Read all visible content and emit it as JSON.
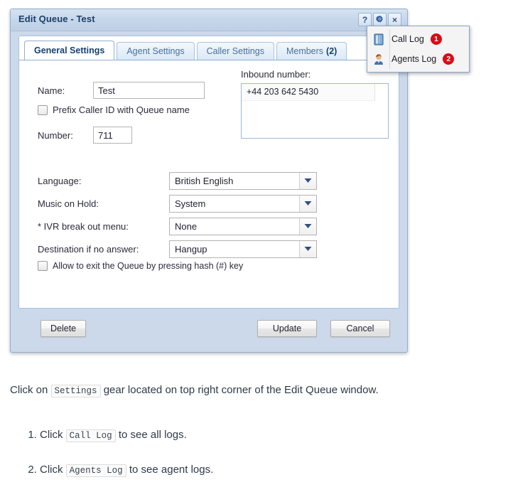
{
  "dialog": {
    "title": "Edit Queue - Test",
    "titlebar_buttons": [
      {
        "name": "help-button",
        "label": "?"
      },
      {
        "name": "settings-gear-button",
        "label": "gear-icon"
      },
      {
        "name": "close-button",
        "label": "×"
      }
    ],
    "tabs": [
      {
        "label": "General Settings",
        "count": "",
        "active": true
      },
      {
        "label": "Agent Settings",
        "count": "",
        "active": false
      },
      {
        "label": "Caller Settings",
        "count": "",
        "active": false
      },
      {
        "label": "Members",
        "count": "(2)",
        "active": false
      }
    ],
    "form": {
      "name_label": "Name:",
      "name_value": "Test",
      "prefix_checkbox_label": "Prefix Caller ID with Queue name",
      "number_label": "Number:",
      "number_value": "711",
      "inbound_caption": "Inbound number:",
      "inbound_options": [
        "+44 203 642 5430"
      ],
      "selects": [
        {
          "label": "Language:",
          "value": "British English"
        },
        {
          "label": "Music on Hold:",
          "value": "System"
        },
        {
          "label": "* IVR break out menu:",
          "value": "None"
        },
        {
          "label": "Destination if no answer:",
          "value": "Hangup"
        }
      ],
      "allow_exit_label": "Allow to exit the Queue by pressing hash (#) key"
    },
    "footer": {
      "delete_label": "Delete",
      "update_label": "Update",
      "cancel_label": "Cancel"
    }
  },
  "menu": {
    "items": [
      {
        "label": "Call Log",
        "badge": "1",
        "icon": "book-icon"
      },
      {
        "label": "Agents Log",
        "badge": "2",
        "icon": "person-icon"
      }
    ]
  },
  "instructions": {
    "intro_before": "Click on",
    "intro_code": "Settings",
    "intro_after": "gear located on top right corner of the Edit Queue window.",
    "steps": [
      {
        "before": "Click",
        "code": "Call Log",
        "after": "to see all logs."
      },
      {
        "before": "Click",
        "code": "Agents Log",
        "after": "to see agent logs."
      }
    ]
  },
  "colors": {
    "dialog_chrome": "#ccd9ea",
    "titlebar_text": "#1b3f68",
    "tab_active_text": "#17406e",
    "badge_red": "#dd0a16",
    "body_text": "#2e3a48"
  }
}
